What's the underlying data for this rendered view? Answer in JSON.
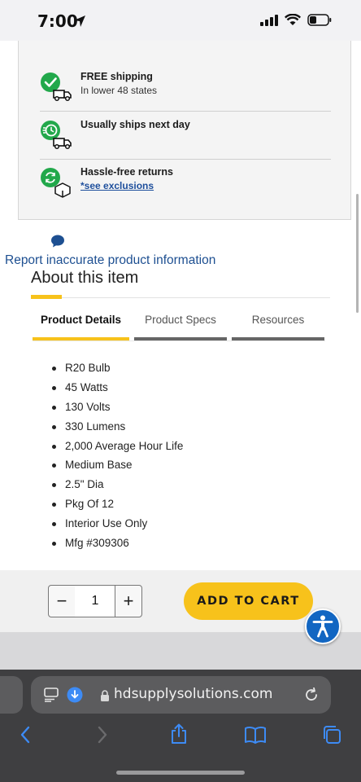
{
  "status_bar": {
    "time": "7:00"
  },
  "features": [
    {
      "icon": "free-shipping-truck-icon",
      "title": "FREE shipping",
      "subtitle": "In lower 48 states"
    },
    {
      "icon": "fast-shipping-clock-truck-icon",
      "title": "Usually ships next day"
    },
    {
      "icon": "returns-box-icon",
      "title": "Hassle-free returns",
      "link": "*see exclusions"
    }
  ],
  "report_link": "Report inaccurate product information",
  "about": {
    "title": "About this item",
    "tabs": [
      {
        "label": "Product Details",
        "active": true
      },
      {
        "label": "Product Specs",
        "active": false
      },
      {
        "label": "Resources",
        "active": false
      }
    ],
    "details": [
      "R20 Bulb",
      "45 Watts",
      "130 Volts",
      "330 Lumens",
      "2,000 Average Hour Life",
      "Medium Base",
      "2.5\" Dia",
      "Pkg Of 12",
      "Interior Use Only",
      "Mfg #309306"
    ]
  },
  "cart": {
    "minus": "−",
    "quantity": "1",
    "plus": "+",
    "add_to_cart": "ADD TO CART"
  },
  "browser": {
    "url": "hdsupplysolutions.com"
  },
  "colors": {
    "accent_yellow": "#f7c21b",
    "link_blue": "#1d4f91",
    "check_green": "#22a84b",
    "toolbar": "#3f3f41",
    "safari_blue": "#3d8bf5"
  }
}
